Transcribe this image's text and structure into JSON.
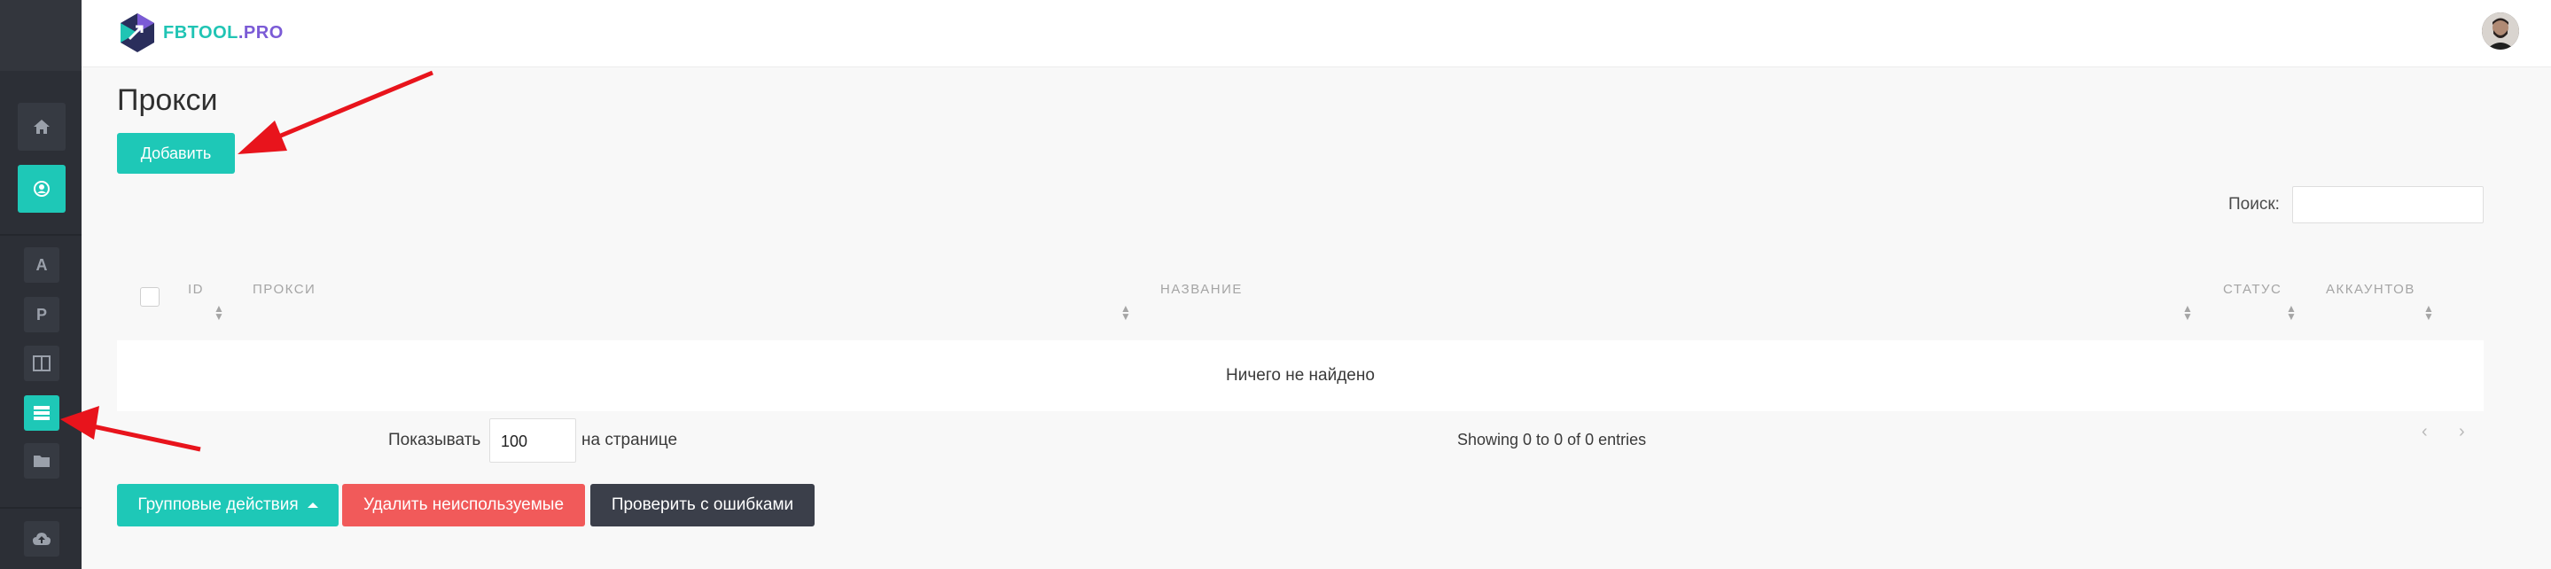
{
  "brand": {
    "logo_main": "FBTOOL",
    "logo_suffix": ".PRO"
  },
  "sidebar": {
    "items": [
      {
        "icon": "home-icon"
      },
      {
        "icon": "user-circle-icon",
        "active": true
      },
      {
        "label": "A"
      },
      {
        "label": "P"
      },
      {
        "icon": "columns-icon"
      },
      {
        "icon": "server-list-icon",
        "active": true
      },
      {
        "icon": "folder-icon"
      },
      {
        "icon": "cloud-upload-icon"
      }
    ]
  },
  "page": {
    "title": "Прокси",
    "add_label": "Добавить"
  },
  "search": {
    "label": "Поиск:",
    "value": ""
  },
  "table": {
    "columns": [
      "ID",
      "ПРОКСИ",
      "НАЗВАНИЕ",
      "СТАТУС",
      "АККАУНТОВ"
    ],
    "empty_text": "Ничего не найдено"
  },
  "pagination": {
    "show_prefix": "Показывать",
    "per_page": "100",
    "show_suffix": "на странице",
    "info": "Showing 0 to 0 of 0 entries",
    "prev": "‹",
    "next": "›"
  },
  "actions": {
    "bulk_label": "Групповые действия",
    "delete_unused_label": "Удалить неиспользуемые",
    "check_errors_label": "Проверить с ошибками"
  },
  "colors": {
    "accent": "#1ec8b7",
    "danger": "#f15a5a",
    "dark": "#3b3f4a",
    "sidebar": "#2c2f36",
    "annotation_arrow": "#e8141c"
  }
}
